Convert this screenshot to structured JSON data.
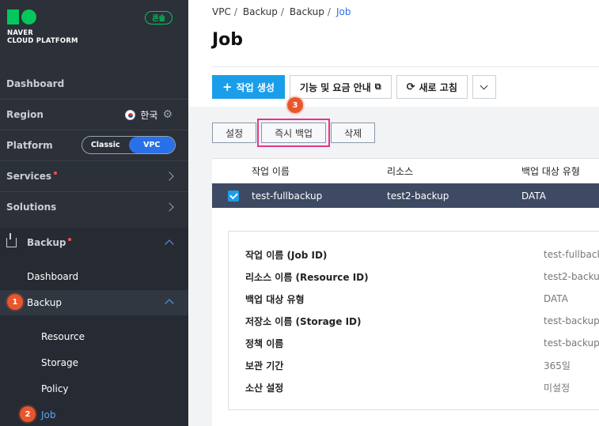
{
  "sidebar": {
    "logo": {
      "line1": "NAVER",
      "line2": "CLOUD PLATFORM"
    },
    "console_badge": "콘솔",
    "dashboard": "Dashboard",
    "region": {
      "label": "Region",
      "value": "한국"
    },
    "platform": {
      "label": "Platform",
      "options": [
        "Classic",
        "VPC"
      ],
      "selected": "VPC"
    },
    "services": "Services",
    "solutions": "Solutions",
    "backup_group": "Backup",
    "sub_items": [
      "Dashboard",
      "Backup",
      "Resource",
      "Storage",
      "Policy",
      "Job"
    ],
    "step_badges": [
      "1",
      "2"
    ]
  },
  "breadcrumb": [
    "VPC",
    "Backup",
    "Backup",
    "Job"
  ],
  "page": {
    "title": "Job"
  },
  "toolbar": {
    "create": "작업 생성",
    "info": "기능 및 요금 안내",
    "refresh": "새로 고침"
  },
  "actions": {
    "settings": "설정",
    "backup_now": "즉시 백업",
    "delete": "삭제",
    "step_badge": "3"
  },
  "table": {
    "headers": [
      "작업 이름",
      "리소스",
      "백업 대상 유형"
    ],
    "row": [
      "test-fullbackup",
      "test2-backup",
      "DATA"
    ]
  },
  "detail": [
    {
      "key": "작업 이름 (Job ID)",
      "value": "test-fullbacku"
    },
    {
      "key": "리소스 이름 (Resource ID)",
      "value": "test2-backup("
    },
    {
      "key": "백업 대상 유형",
      "value": "DATA"
    },
    {
      "key": "저장소 이름 (Storage ID)",
      "value": "test-backup-s"
    },
    {
      "key": "정책 이름",
      "value": "test-backup-p"
    },
    {
      "key": "보관 기간",
      "value": "365일"
    },
    {
      "key": "소산 설정",
      "value": "미설정"
    }
  ],
  "colors": {
    "accent": "#1a9eea",
    "brand": "#03c75a",
    "badge": "#e8562d",
    "highlight": "#e8328a"
  }
}
